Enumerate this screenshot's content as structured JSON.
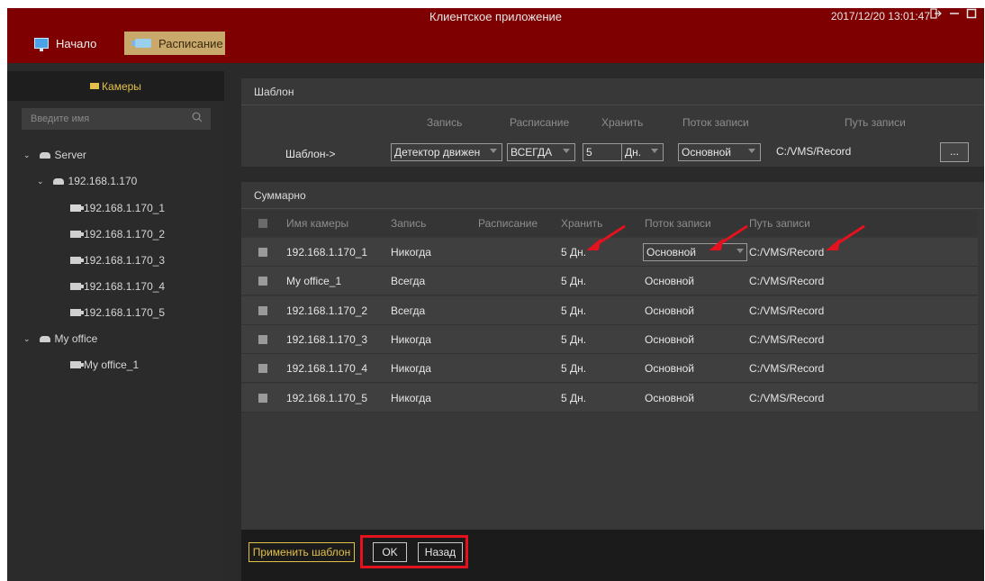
{
  "titlebar": {
    "app_title": "Клиентское приложение",
    "datetime": "2017/12/20 13:01:47",
    "nav": [
      {
        "label": "Начало",
        "icon": "monitor-icon"
      },
      {
        "label": "Расписание",
        "icon": "camera-icon",
        "active": true
      }
    ],
    "window_buttons": [
      "logout-icon",
      "minimize-icon",
      "maximize-icon"
    ]
  },
  "sidebar": {
    "header": "Камеры",
    "search_placeholder": "Введите имя",
    "tree": [
      {
        "label": "Server",
        "type": "server"
      },
      {
        "label": "192.168.1.170",
        "type": "group"
      },
      {
        "label": "192.168.1.170_1",
        "type": "camera"
      },
      {
        "label": "192.168.1.170_2",
        "type": "camera"
      },
      {
        "label": "192.168.1.170_3",
        "type": "camera"
      },
      {
        "label": "192.168.1.170_4",
        "type": "camera"
      },
      {
        "label": "192.168.1.170_5",
        "type": "camera"
      },
      {
        "label": "My office",
        "type": "group"
      },
      {
        "label": "My office_1",
        "type": "camera"
      }
    ]
  },
  "template": {
    "title": "Шаблон",
    "headers": [
      "Запись",
      "Расписание",
      "Хранить",
      "Поток записи",
      "Путь записи"
    ],
    "row_label": "Шаблон->",
    "record": "Детектор движен",
    "schedule": "ВСЕГДА",
    "keep_value": "5",
    "keep_unit": "Дн.",
    "stream": "Основной",
    "path": "C:/VMS/Record",
    "browse_label": "..."
  },
  "summary": {
    "title": "Суммарно",
    "headers": [
      "Имя камеры",
      "Запись",
      "Расписание",
      "Хранить",
      "Поток записи",
      "Путь записи"
    ],
    "rows": [
      {
        "name": "192.168.1.170_1",
        "record": "Никогда",
        "schedule": "",
        "keep": "5 Дн.",
        "stream": "Основной",
        "path": "C:/VMS/Record"
      },
      {
        "name": "My office_1",
        "record": "Всегда",
        "schedule": "",
        "keep": "5 Дн.",
        "stream": "Основной",
        "path": "C:/VMS/Record"
      },
      {
        "name": "192.168.1.170_2",
        "record": "Всегда",
        "schedule": "",
        "keep": "5 Дн.",
        "stream": "Основной",
        "path": "C:/VMS/Record"
      },
      {
        "name": "192.168.1.170_3",
        "record": "Никогда",
        "schedule": "",
        "keep": "5 Дн.",
        "stream": "Основной",
        "path": "C:/VMS/Record"
      },
      {
        "name": "192.168.1.170_4",
        "record": "Никогда",
        "schedule": "",
        "keep": "5 Дн.",
        "stream": "Основной",
        "path": "C:/VMS/Record"
      },
      {
        "name": "192.168.1.170_5",
        "record": "Никогда",
        "schedule": "",
        "keep": "5 Дн.",
        "stream": "Основной",
        "path": "C:/VMS/Record"
      }
    ]
  },
  "footer": {
    "apply_label": "Применить шаблон",
    "ok_label": "OK",
    "back_label": "Назад"
  },
  "colors": {
    "titlebar": "#7e0000",
    "accent_yellow": "#e2c04a",
    "annotation_red": "#e4121e"
  }
}
